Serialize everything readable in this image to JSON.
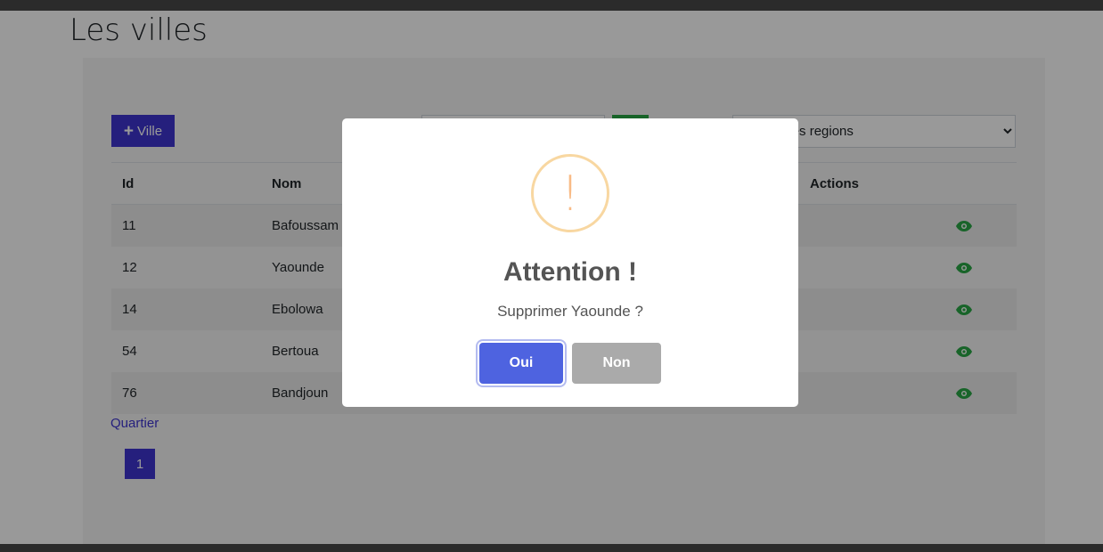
{
  "page": {
    "title": "Les villes"
  },
  "toolbar": {
    "add_label": "Ville",
    "add_icon": "plus-icon",
    "search_value": "",
    "region_select_value": "Toutes les regions"
  },
  "table": {
    "headers": [
      "Id",
      "Nom",
      "Actions"
    ],
    "rows": [
      {
        "id": "11",
        "nom": "Bafoussam"
      },
      {
        "id": "12",
        "nom": "Yaounde"
      },
      {
        "id": "14",
        "nom": "Ebolowa"
      },
      {
        "id": "54",
        "nom": "Bertoua"
      },
      {
        "id": "76",
        "nom": "Bandjoun"
      }
    ],
    "row_action_icon": "eye-icon"
  },
  "links": {
    "quartier": "Quartier"
  },
  "pagination": {
    "current": "1"
  },
  "dialog": {
    "icon": "warning-icon",
    "icon_glyph": "!",
    "title": "Attention !",
    "text": "Supprimer Yaounde ?",
    "confirm_label": "Oui",
    "cancel_label": "Non"
  },
  "colors": {
    "accent": "#3f35d0",
    "confirm": "#4e63e0",
    "cancel": "#aaaaaa",
    "warning": "#f8bb86",
    "view_icon": "#28a745"
  }
}
